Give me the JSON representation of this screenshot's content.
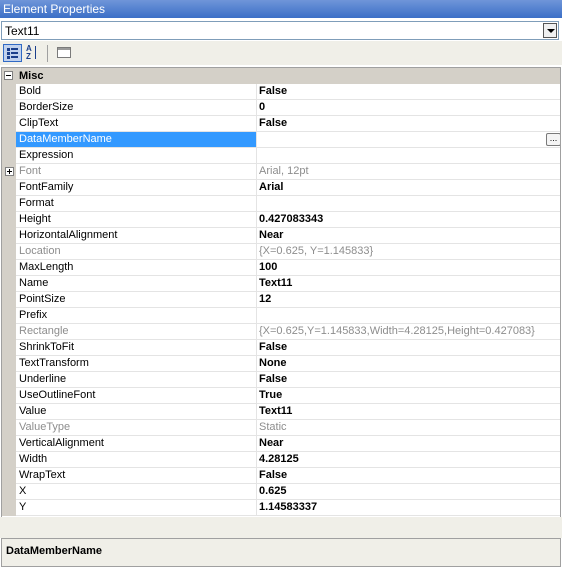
{
  "window": {
    "title": "Element Properties"
  },
  "object_selector": {
    "value": "Text11"
  },
  "toolbar": {
    "categorized_icon": "categorized-icon",
    "alphabetical_icon": "alphabetical-sort-icon",
    "property_pages_icon": "property-pages-icon"
  },
  "grid": {
    "category": "Misc",
    "rows": [
      {
        "name": "Bold",
        "value": "False"
      },
      {
        "name": "BorderSize",
        "value": "0"
      },
      {
        "name": "ClipText",
        "value": "False"
      },
      {
        "name": "DataMemberName",
        "value": ""
      },
      {
        "name": "Expression",
        "value": ""
      },
      {
        "name": "Font",
        "value": "Arial, 12pt"
      },
      {
        "name": "FontFamily",
        "value": "Arial"
      },
      {
        "name": "Format",
        "value": ""
      },
      {
        "name": "Height",
        "value": "0.427083343"
      },
      {
        "name": "HorizontalAlignment",
        "value": "Near"
      },
      {
        "name": "Location",
        "value": "{X=0.625, Y=1.145833}"
      },
      {
        "name": "MaxLength",
        "value": "100"
      },
      {
        "name": "Name",
        "value": "Text11"
      },
      {
        "name": "PointSize",
        "value": "12"
      },
      {
        "name": "Prefix",
        "value": ""
      },
      {
        "name": "Rectangle",
        "value": "{X=0.625,Y=1.145833,Width=4.28125,Height=0.427083}"
      },
      {
        "name": "ShrinkToFit",
        "value": "False"
      },
      {
        "name": "TextTransform",
        "value": "None"
      },
      {
        "name": "Underline",
        "value": "False"
      },
      {
        "name": "UseOutlineFont",
        "value": "True"
      },
      {
        "name": "Value",
        "value": "Text11"
      },
      {
        "name": "ValueType",
        "value": "Static"
      },
      {
        "name": "VerticalAlignment",
        "value": "Near"
      },
      {
        "name": "Width",
        "value": "4.28125"
      },
      {
        "name": "WrapText",
        "value": "False"
      },
      {
        "name": "X",
        "value": "0.625"
      },
      {
        "name": "Y",
        "value": "1.14583337"
      }
    ],
    "ellipsis_label": "..."
  },
  "description": {
    "title": "DataMemberName"
  }
}
